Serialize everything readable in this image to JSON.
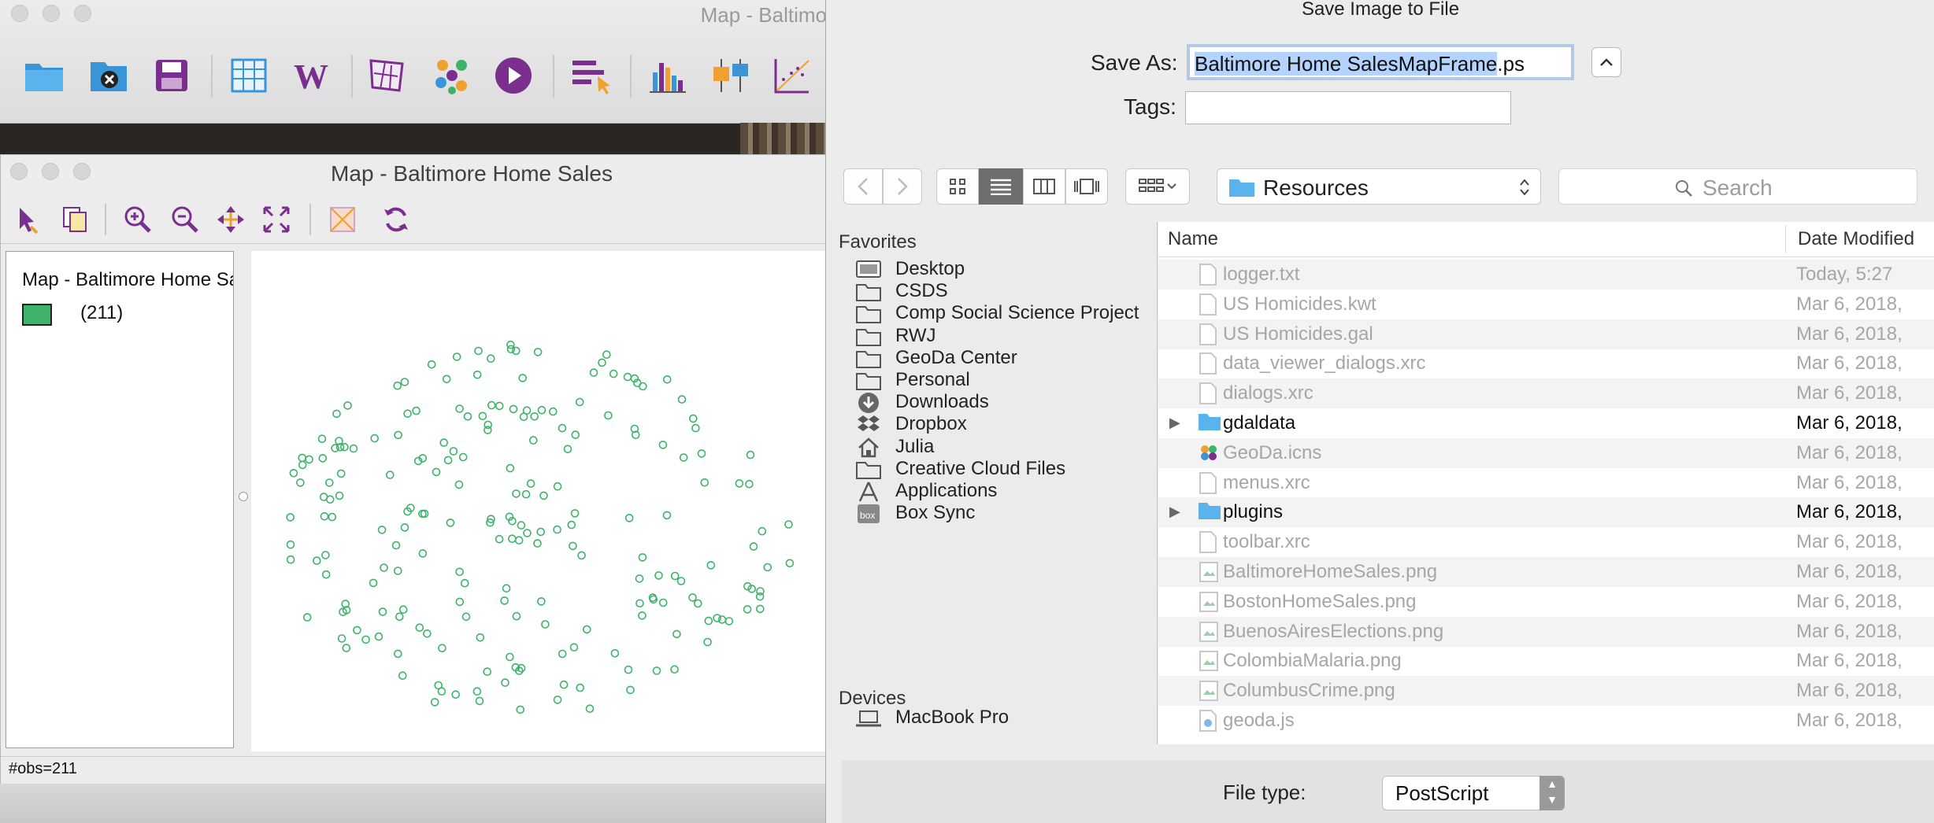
{
  "main_window": {
    "title": "Map - Baltimo",
    "toolbar_icons": [
      "open-folder-icon",
      "close-project-icon",
      "save-icon",
      "table-icon",
      "weights-w-icon",
      "polygon-map-icon",
      "connectivity-icon",
      "play-icon",
      "selection-tool-icon",
      "histogram-icon",
      "boxplot-icon",
      "scatterplot-icon"
    ]
  },
  "map_window": {
    "title": "Map - Baltimore Home Sales",
    "toolbar_icons": [
      "select-arrow-icon",
      "copy-icon",
      "zoom-in-icon",
      "zoom-out-icon",
      "pan-icon",
      "fit-extent-icon",
      "map-layer-icon",
      "refresh-icon"
    ],
    "legend": {
      "title": "Map - Baltimore Home Sa",
      "category_count": "(211)",
      "swatch_color": "#3db36a"
    },
    "status": "#obs=211",
    "point_color": "#3db36a"
  },
  "dialog": {
    "title": "Save Image to File",
    "save_as_label": "Save As:",
    "filename_selected": "Baltimore Home SalesMapFrame",
    "filename_ext": ".ps",
    "tags_label": "Tags:",
    "location": "Resources",
    "search_placeholder": "Search",
    "favorites_header": "Favorites",
    "favorites": [
      {
        "label": "Desktop",
        "icon": "desktop-icon"
      },
      {
        "label": "CSDS",
        "icon": "folder-icon"
      },
      {
        "label": "Comp Social Science Project",
        "icon": "folder-icon"
      },
      {
        "label": "RWJ",
        "icon": "folder-icon"
      },
      {
        "label": "GeoDa Center",
        "icon": "folder-icon"
      },
      {
        "label": "Personal",
        "icon": "folder-icon"
      },
      {
        "label": "Downloads",
        "icon": "downloads-icon"
      },
      {
        "label": "Dropbox",
        "icon": "dropbox-icon"
      },
      {
        "label": "Julia",
        "icon": "home-icon"
      },
      {
        "label": "Creative Cloud Files",
        "icon": "folder-icon"
      },
      {
        "label": "Applications",
        "icon": "applications-icon"
      },
      {
        "label": "Box Sync",
        "icon": "box-icon"
      }
    ],
    "devices_header": "Devices",
    "devices": [
      {
        "label": "MacBook Pro",
        "icon": "laptop-icon"
      }
    ],
    "columns": {
      "name": "Name",
      "date": "Date Modified"
    },
    "files": [
      {
        "name": "logger.txt",
        "date": "Today, 5:27",
        "kind": "doc",
        "enabled": false
      },
      {
        "name": "US Homicides.kwt",
        "date": "Mar 6, 2018,",
        "kind": "doc",
        "enabled": false
      },
      {
        "name": "US Homicides.gal",
        "date": "Mar 6, 2018,",
        "kind": "doc",
        "enabled": false
      },
      {
        "name": "data_viewer_dialogs.xrc",
        "date": "Mar 6, 2018,",
        "kind": "doc",
        "enabled": false
      },
      {
        "name": "dialogs.xrc",
        "date": "Mar 6, 2018,",
        "kind": "doc",
        "enabled": false
      },
      {
        "name": "gdaldata",
        "date": "Mar 6, 2018,",
        "kind": "folder",
        "enabled": true
      },
      {
        "name": "GeoDa.icns",
        "date": "Mar 6, 2018,",
        "kind": "icns",
        "enabled": false
      },
      {
        "name": "menus.xrc",
        "date": "Mar 6, 2018,",
        "kind": "doc",
        "enabled": false
      },
      {
        "name": "plugins",
        "date": "Mar 6, 2018,",
        "kind": "folder",
        "enabled": true
      },
      {
        "name": "toolbar.xrc",
        "date": "Mar 6, 2018,",
        "kind": "doc",
        "enabled": false
      },
      {
        "name": "BaltimoreHomeSales.png",
        "date": "Mar 6, 2018,",
        "kind": "image",
        "enabled": false
      },
      {
        "name": "BostonHomeSales.png",
        "date": "Mar 6, 2018,",
        "kind": "image",
        "enabled": false
      },
      {
        "name": "BuenosAiresElections.png",
        "date": "Mar 6, 2018,",
        "kind": "image",
        "enabled": false
      },
      {
        "name": "ColombiaMalaria.png",
        "date": "Mar 6, 2018,",
        "kind": "image",
        "enabled": false
      },
      {
        "name": "ColumbusCrime.png",
        "date": "Mar 6, 2018,",
        "kind": "image",
        "enabled": false
      },
      {
        "name": "geoda.js",
        "date": "Mar 6, 2018,",
        "kind": "js",
        "enabled": false
      }
    ],
    "file_type_label": "File type:",
    "file_type_value": "PostScript"
  }
}
